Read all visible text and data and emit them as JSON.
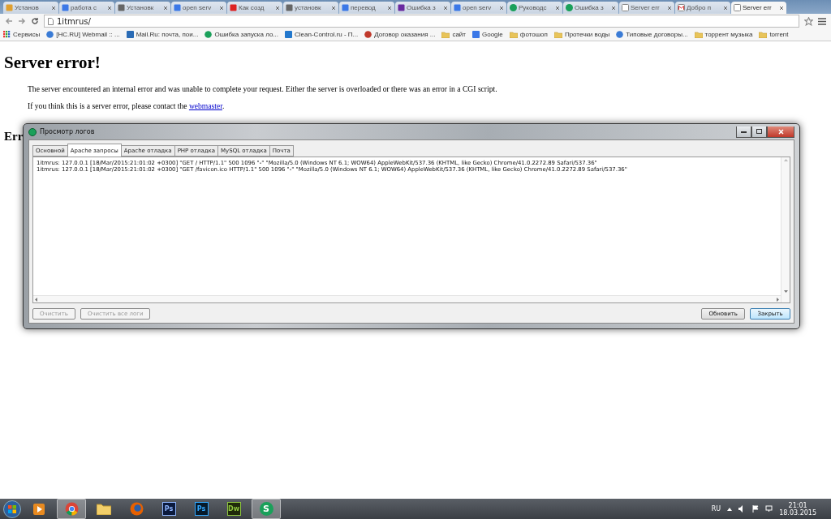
{
  "browser": {
    "tabs": [
      {
        "title": "Установ",
        "selected": false
      },
      {
        "title": "работа с",
        "selected": false
      },
      {
        "title": "Установк",
        "selected": false
      },
      {
        "title": "open serv",
        "selected": false
      },
      {
        "title": "Как созд",
        "selected": false
      },
      {
        "title": "установк",
        "selected": false
      },
      {
        "title": "перевод",
        "selected": false
      },
      {
        "title": "Ошибка з",
        "selected": false
      },
      {
        "title": "open serv",
        "selected": false
      },
      {
        "title": "Руководс",
        "selected": false
      },
      {
        "title": "Ошибка з",
        "selected": false
      },
      {
        "title": "Server err",
        "selected": false
      },
      {
        "title": "Добро п",
        "selected": false
      },
      {
        "title": "Server err",
        "selected": true
      }
    ],
    "address": "1itmrus/",
    "bookmarks": [
      {
        "label": "Сервисы"
      },
      {
        "label": "[HC.RU] Webmail :: ..."
      },
      {
        "label": "Mail.Ru: почта, пои..."
      },
      {
        "label": "Ошибка запуска ло..."
      },
      {
        "label": "Clean-Control.ru - П..."
      },
      {
        "label": "Договор оказания ..."
      },
      {
        "label": "сайт"
      },
      {
        "label": "Google"
      },
      {
        "label": "фотошоп"
      },
      {
        "label": "Протечки воды"
      },
      {
        "label": "Типовые договоры..."
      },
      {
        "label": "торрент музыка"
      },
      {
        "label": "torrent"
      }
    ]
  },
  "page": {
    "heading": "Server error!",
    "paragraphs": [
      "The server encountered an internal error and was unable to complete your request. Either the server is overloaded or there was an error in a CGI script."
    ],
    "contact_text": "If you think this is a server error, please contact the ",
    "contact_link": "webmaster",
    "contact_end": ".",
    "subheading": "Err"
  },
  "dialog": {
    "title": "Просмотр логов",
    "tabs": [
      {
        "label": "Основной",
        "selected": false
      },
      {
        "label": "Apache запросы",
        "selected": true
      },
      {
        "label": "Apache отладка",
        "selected": false
      },
      {
        "label": "PHP отладка",
        "selected": false
      },
      {
        "label": "MySQL отладка",
        "selected": false
      },
      {
        "label": "Почта",
        "selected": false
      }
    ],
    "log_lines": [
      "1itmrus: 127.0.0.1 [18/Mar/2015:21:01:02 +0300] \"GET / HTTP/1.1\" 500 1096 \"-\" \"Mozilla/5.0 (Windows NT 6.1; WOW64) AppleWebKit/537.36 (KHTML, like Gecko) Chrome/41.0.2272.89 Safari/537.36\"",
      "1itmrus: 127.0.0.1 [18/Mar/2015:21:01:02 +0300] \"GET /favicon.ico HTTP/1.1\" 500 1096 \"-\" \"Mozilla/5.0 (Windows NT 6.1; WOW64) AppleWebKit/537.36 (KHTML, like Gecko) Chrome/41.0.2272.89 Safari/537.36\""
    ],
    "left_buttons": [
      {
        "label": "Очистить",
        "disabled": true
      },
      {
        "label": "Очистить все логи",
        "disabled": true
      }
    ],
    "right_buttons": [
      {
        "label": "Обновить",
        "default": false
      },
      {
        "label": "Закрыть",
        "default": true
      }
    ]
  },
  "taskbar": {
    "apps": [
      {
        "kind": "media",
        "active": false
      },
      {
        "kind": "chrome",
        "active": true
      },
      {
        "kind": "explorer",
        "active": false
      },
      {
        "kind": "firefox",
        "active": false
      },
      {
        "kind": "ps",
        "label": "Ps",
        "active": false
      },
      {
        "kind": "ps2",
        "label": "Ps",
        "active": false
      },
      {
        "kind": "dw",
        "label": "Dw",
        "active": false
      },
      {
        "kind": "s",
        "label": "S",
        "active": true
      }
    ],
    "language": "RU",
    "time": "21:01",
    "date": "18.03.2015"
  }
}
